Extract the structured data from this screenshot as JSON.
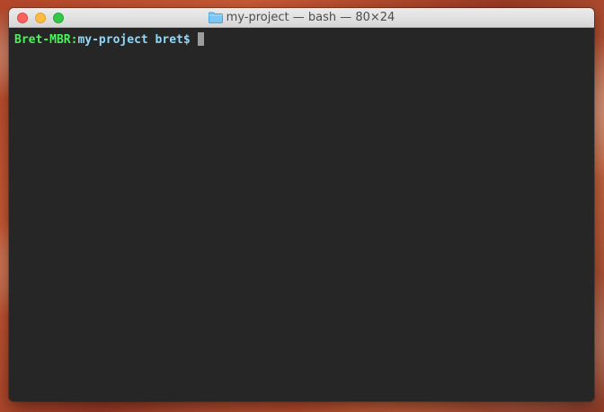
{
  "window": {
    "title": "my-project — bash — 80×24",
    "folder_icon": "folder-icon",
    "buttons": {
      "close": "close-button",
      "minimize": "minimize-button",
      "zoom": "zoom-button"
    }
  },
  "terminal": {
    "prompt_host": "Bret-MBR:",
    "prompt_path": "my-project bret$",
    "command": ""
  },
  "colors": {
    "background": "#262626",
    "host": "#4cf35b",
    "path": "#8fd9fb",
    "cursor": "#9d9d9d",
    "close": "#fc615d",
    "minimize": "#fdbc40",
    "zoom": "#34c84a"
  }
}
